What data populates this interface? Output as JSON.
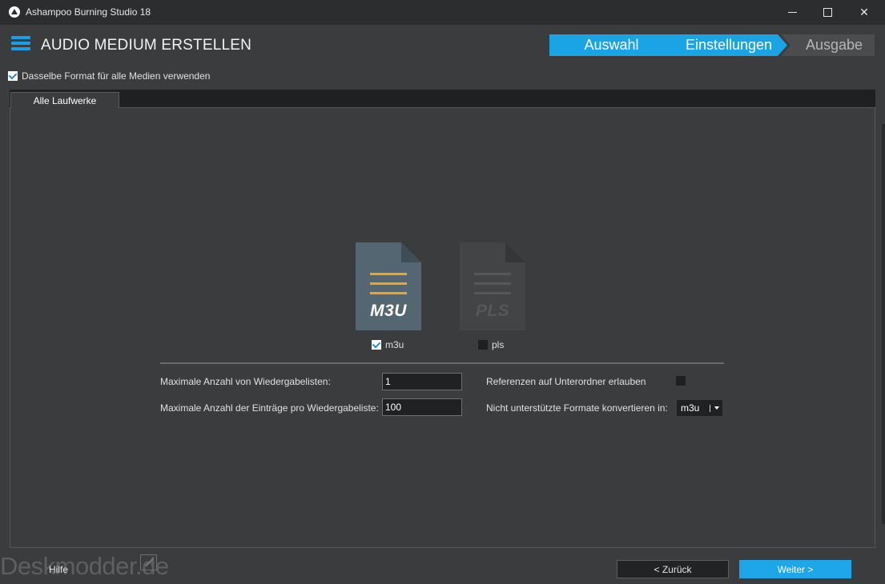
{
  "window": {
    "title": "Ashampoo Burning Studio 18",
    "controls": {
      "minimize": "—",
      "maximize": "□",
      "close": "✕"
    }
  },
  "header": {
    "title": "AUDIO MEDIUM ERSTELLEN",
    "steps": [
      {
        "label": "Auswahl",
        "state": "done"
      },
      {
        "label": "Einstellungen",
        "state": "active"
      },
      {
        "label": "Ausgabe",
        "state": "pending"
      }
    ]
  },
  "options": {
    "same_format_label": "Dasselbe Format für alle Medien verwenden",
    "same_format_checked": true
  },
  "tabs": [
    {
      "label": "Alle Laufwerke",
      "selected": true
    }
  ],
  "formats": [
    {
      "id": "m3u",
      "icon_text": "M3U",
      "label": "m3u",
      "checked": true,
      "icon": "m3u-file-icon"
    },
    {
      "id": "pls",
      "icon_text": "PLS",
      "label": "pls",
      "checked": false,
      "icon": "pls-file-icon"
    }
  ],
  "settings": {
    "max_playlists_label": "Maximale Anzahl von Wiedergabelisten:",
    "max_playlists_value": "1",
    "max_entries_label": "Maximale Anzahl der Einträge pro Wiedergabeliste:",
    "max_entries_value": "100",
    "subfolder_refs_label": "Referenzen auf Unterordner erlauben",
    "subfolder_refs_checked": false,
    "convert_label": "Nicht unterstützte Formate konvertieren in:",
    "convert_value": "m3u"
  },
  "footer": {
    "watermark": "Deskmodder.de",
    "help_label": "Hilfe",
    "back_label": "< Zurück",
    "next_label": "Weiter >"
  },
  "colors": {
    "accent": "#1aa3e5",
    "m3u_lines": "#f2a51b",
    "background": "#3b3c3d"
  }
}
